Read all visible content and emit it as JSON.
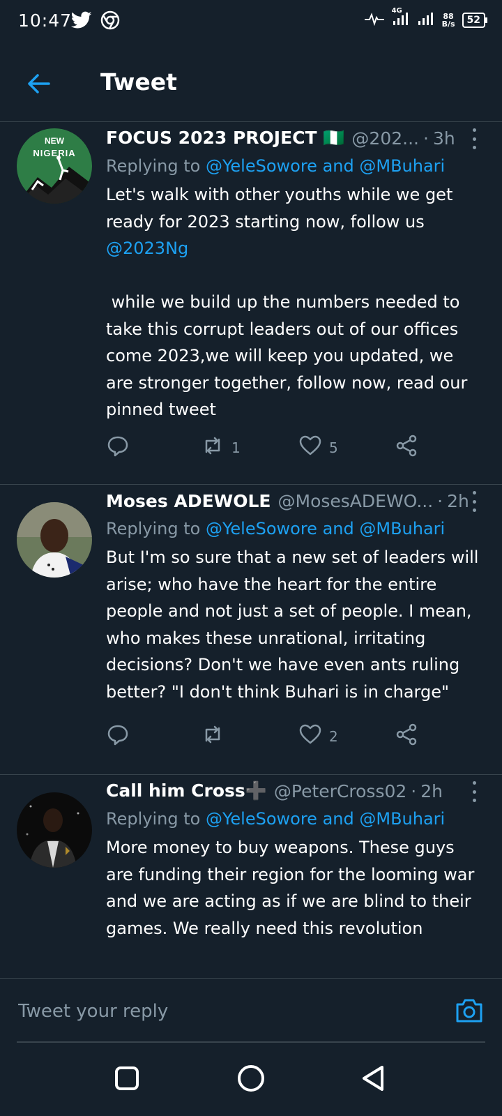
{
  "status_bar": {
    "time": "10:47",
    "net_type": "4G",
    "speed_value": "88",
    "speed_unit": "B/s",
    "battery": "52"
  },
  "header": {
    "title": "Tweet"
  },
  "tweets": [
    {
      "name": "FOCUS 2023 PROJECT 🇳🇬",
      "handle": "@202...",
      "time": "3h",
      "replying_prefix": "Replying to ",
      "reply_to": "@YeleSowore and @MBuhari",
      "text_part1": "Let's walk with other youths while we get ready for 2023 starting now, follow us ",
      "text_mention": "@2023Ng",
      "text_part2": "\n\n while we build up the numbers needed to take this corrupt leaders out of our offices come 2023,we will keep you updated, we are stronger together, follow now, read our pinned tweet",
      "retweets": "1",
      "likes": "5",
      "avatar_label": "NEW NIGERIA"
    },
    {
      "name": "Moses ADEWOLE",
      "handle": "@MosesADEWO...",
      "time": "2h",
      "replying_prefix": "Replying to ",
      "reply_to": "@YeleSowore and @MBuhari",
      "text": "But I'm so sure that a new set of leaders will arise; who have the heart for the entire people and not just a set of people. I mean, who makes these unrational, irritating decisions? Don't we have even ants ruling better? \"I don't think Buhari is in charge\"",
      "retweets": "",
      "likes": "2"
    },
    {
      "name": "Call him Cross➕",
      "handle": "@PeterCross02",
      "time": "2h",
      "replying_prefix": "Replying to ",
      "reply_to": "@YeleSowore and @MBuhari",
      "text": "More money to buy weapons. These guys are funding their region for the looming war and we are acting as if we are blind to their games. We really need this revolution"
    }
  ],
  "composer": {
    "placeholder": "Tweet your reply"
  },
  "colors": {
    "background": "#15202b",
    "accent": "#1da1f2",
    "secondary_text": "#8899a6",
    "divider": "#38444d"
  }
}
